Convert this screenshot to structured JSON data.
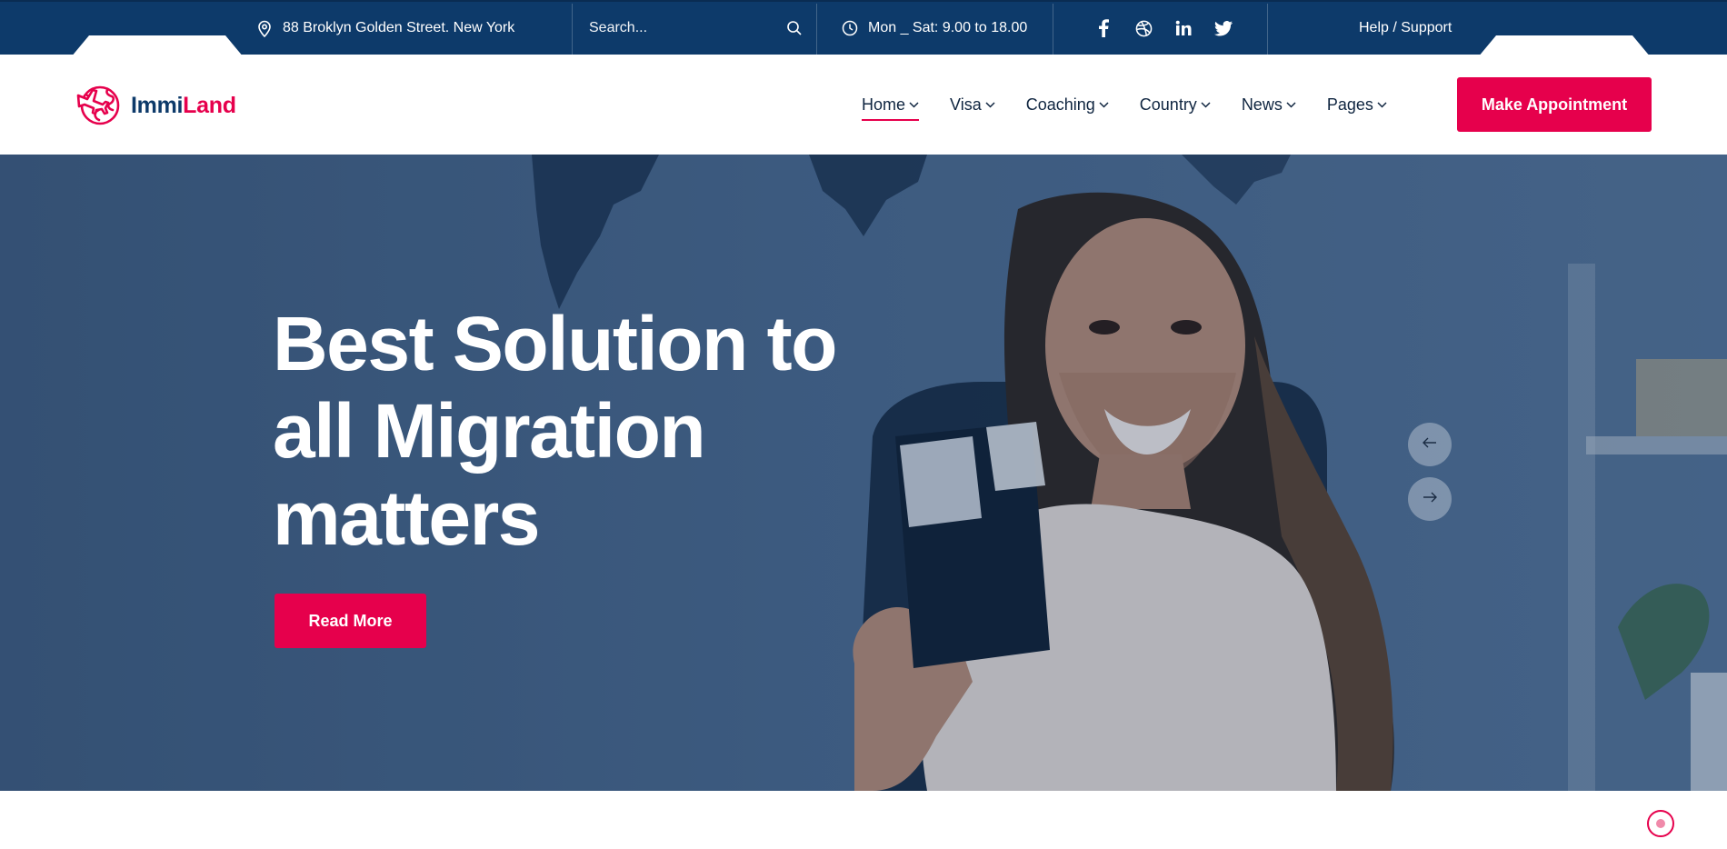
{
  "topbar": {
    "address": "88 Broklyn Golden Street. New York",
    "address_icon": "map-pin-icon",
    "search_placeholder": "Search...",
    "search_icon": "search-icon",
    "hours": "Mon _ Sat: 9.00 to 18.00",
    "hours_icon": "clock-icon",
    "social": [
      "facebook-icon",
      "dribbble-icon",
      "linkedin-icon",
      "twitter-icon"
    ],
    "help": "Help / Support"
  },
  "header": {
    "logo_part1": "Immi",
    "logo_part2": "Land",
    "logo_icon": "plane-globe-icon",
    "nav": [
      {
        "label": "Home",
        "active": true
      },
      {
        "label": "Visa",
        "active": false
      },
      {
        "label": "Coaching",
        "active": false
      },
      {
        "label": "Country",
        "active": false
      },
      {
        "label": "News",
        "active": false
      },
      {
        "label": "Pages",
        "active": false
      }
    ],
    "cta": "Make Appointment"
  },
  "hero": {
    "title_line1": "Best Solution to",
    "title_line2": "all Migration",
    "title_line3": "matters",
    "button": "Read More",
    "prev_icon": "arrow-left-icon",
    "next_icon": "arrow-right-icon"
  },
  "colors": {
    "topbar": "#0d3a6a",
    "accent": "#e6004c",
    "nav_text": "#0f2540"
  }
}
